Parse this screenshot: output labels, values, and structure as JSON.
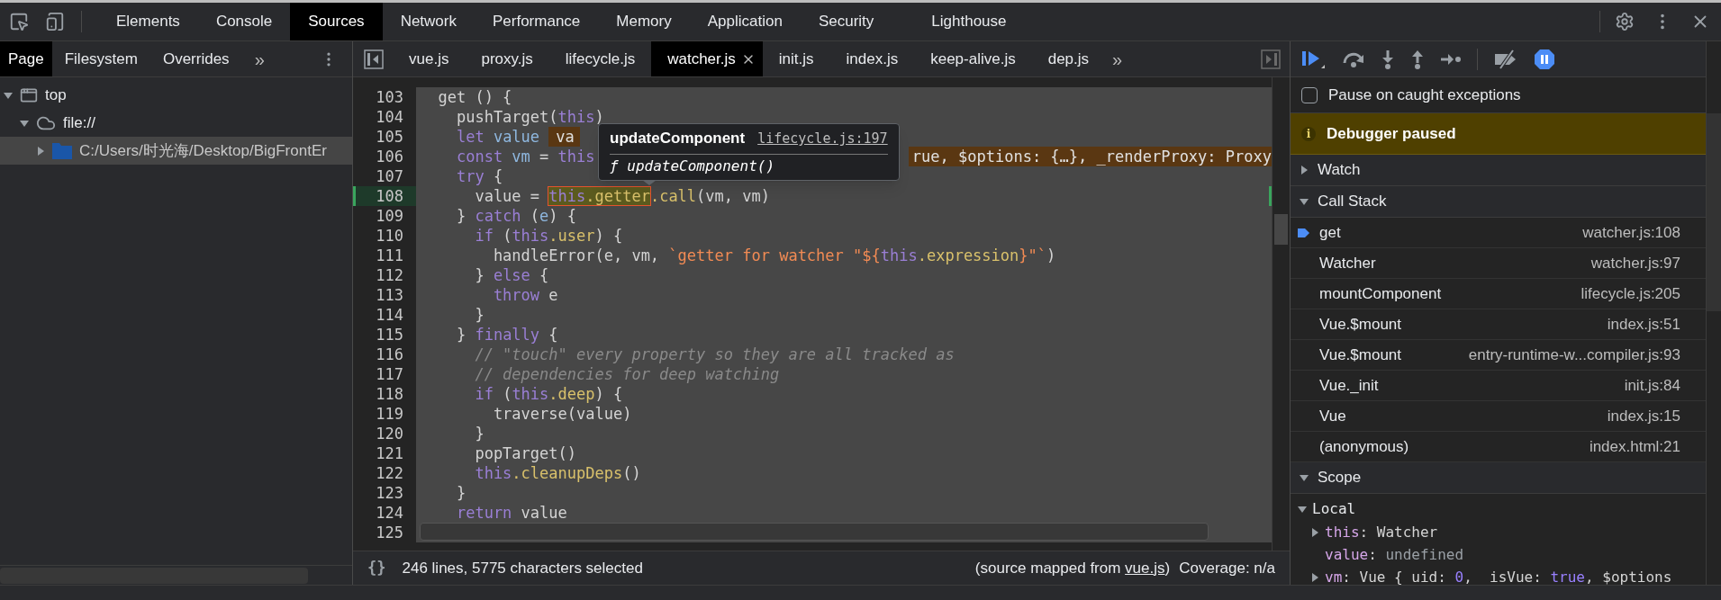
{
  "main_tabs": [
    {
      "label": "Elements",
      "selected": false
    },
    {
      "label": "Console",
      "selected": false
    },
    {
      "label": "Sources",
      "selected": true
    },
    {
      "label": "Network",
      "selected": false
    },
    {
      "label": "Performance",
      "selected": false
    },
    {
      "label": "Memory",
      "selected": false
    },
    {
      "label": "Application",
      "selected": false
    },
    {
      "label": "Security",
      "selected": false
    },
    {
      "label": "Lighthouse",
      "selected": false
    }
  ],
  "navigator": {
    "tabs": [
      {
        "label": "Page",
        "selected": true
      },
      {
        "label": "Filesystem",
        "selected": false
      },
      {
        "label": "Overrides",
        "selected": false
      }
    ],
    "more": "»",
    "tree": [
      {
        "label": "top",
        "kind": "frame",
        "expanded": true,
        "selected": false,
        "children": [
          {
            "label": "file://",
            "kind": "domain",
            "expanded": true,
            "selected": false,
            "children": [
              {
                "label": "C:/Users/时光海/Desktop/BigFrontEr",
                "kind": "folder",
                "expanded": false,
                "selected": true
              }
            ]
          }
        ]
      }
    ]
  },
  "editor": {
    "tabs": [
      {
        "label": "vue.js",
        "selected": false
      },
      {
        "label": "proxy.js",
        "selected": false
      },
      {
        "label": "lifecycle.js",
        "selected": false
      },
      {
        "label": "watcher.js",
        "selected": true
      },
      {
        "label": "init.js",
        "selected": false
      },
      {
        "label": "index.js",
        "selected": false
      },
      {
        "label": "keep-alive.js",
        "selected": false
      },
      {
        "label": "dep.js",
        "selected": false
      }
    ],
    "more": "»",
    "lines": [
      {
        "n": "103",
        "current": false,
        "tokens": [
          {
            "kind": "plain",
            "t": "  get () {"
          }
        ]
      },
      {
        "n": "104",
        "current": false,
        "tokens": [
          {
            "kind": "plain",
            "t": "    pushTarget("
          },
          {
            "kind": "kw",
            "t": "this"
          },
          {
            "kind": "plain",
            "t": ")"
          }
        ]
      },
      {
        "n": "105",
        "current": false,
        "tokens": [
          {
            "kind": "kw",
            "t": "    let"
          },
          {
            "kind": "def",
            "t": " value "
          },
          {
            "kind": "inline",
            "t": "va"
          }
        ]
      },
      {
        "n": "106",
        "current": false,
        "tokens": [
          {
            "kind": "kw",
            "t": "    const"
          },
          {
            "kind": "def",
            "t": " vm"
          },
          {
            "kind": "plain",
            "t": " = "
          },
          {
            "kind": "kw",
            "t": "this"
          },
          {
            "kind": "inline-end",
            "t": "rue, $options: {…}, _renderProxy: Proxy"
          }
        ]
      },
      {
        "n": "107",
        "current": false,
        "tokens": [
          {
            "kind": "kw",
            "t": "    try"
          },
          {
            "kind": "plain",
            "t": " {"
          }
        ]
      },
      {
        "n": "108",
        "current": true,
        "tokens": [
          {
            "kind": "plain",
            "t": "      value = "
          },
          {
            "kind": "eval",
            "parts": [
              {
                "kind": "kw",
                "t": "this"
              },
              {
                "kind": "prop",
                "t": ".getter"
              }
            ]
          },
          {
            "kind": "prop",
            "t": ".call"
          },
          {
            "kind": "plain",
            "t": "(vm, vm)"
          }
        ]
      },
      {
        "n": "109",
        "current": false,
        "tokens": [
          {
            "kind": "plain",
            "t": "    } "
          },
          {
            "kind": "kw",
            "t": "catch"
          },
          {
            "kind": "plain",
            "t": " ("
          },
          {
            "kind": "def",
            "t": "e"
          },
          {
            "kind": "plain",
            "t": ") {"
          }
        ]
      },
      {
        "n": "110",
        "current": false,
        "tokens": [
          {
            "kind": "kw",
            "t": "      if"
          },
          {
            "kind": "plain",
            "t": " ("
          },
          {
            "kind": "kw",
            "t": "this"
          },
          {
            "kind": "prop",
            "t": ".user"
          },
          {
            "kind": "plain",
            "t": ") {"
          }
        ]
      },
      {
        "n": "111",
        "current": false,
        "tokens": [
          {
            "kind": "plain",
            "t": "        handleError(e, vm, "
          },
          {
            "kind": "str",
            "t": "`getter for watcher \"${"
          },
          {
            "kind": "kw",
            "t": "this"
          },
          {
            "kind": "prop",
            "t": ".expression"
          },
          {
            "kind": "str",
            "t": "}\"`"
          },
          {
            "kind": "plain",
            "t": ")"
          }
        ]
      },
      {
        "n": "112",
        "current": false,
        "tokens": [
          {
            "kind": "plain",
            "t": "      } "
          },
          {
            "kind": "kw",
            "t": "else"
          },
          {
            "kind": "plain",
            "t": " {"
          }
        ]
      },
      {
        "n": "113",
        "current": false,
        "tokens": [
          {
            "kind": "kw",
            "t": "        throw"
          },
          {
            "kind": "plain",
            "t": " e"
          }
        ]
      },
      {
        "n": "114",
        "current": false,
        "tokens": [
          {
            "kind": "plain",
            "t": "      }"
          }
        ]
      },
      {
        "n": "115",
        "current": false,
        "tokens": [
          {
            "kind": "plain",
            "t": "    } "
          },
          {
            "kind": "kw",
            "t": "finally"
          },
          {
            "kind": "plain",
            "t": " {"
          }
        ]
      },
      {
        "n": "116",
        "current": false,
        "tokens": [
          {
            "kind": "cm",
            "t": "      // \"touch\" every property so they are all tracked as"
          }
        ]
      },
      {
        "n": "117",
        "current": false,
        "tokens": [
          {
            "kind": "cm",
            "t": "      // dependencies for deep watching"
          }
        ]
      },
      {
        "n": "118",
        "current": false,
        "tokens": [
          {
            "kind": "kw",
            "t": "      if"
          },
          {
            "kind": "plain",
            "t": " ("
          },
          {
            "kind": "kw",
            "t": "this"
          },
          {
            "kind": "prop",
            "t": ".deep"
          },
          {
            "kind": "plain",
            "t": ") {"
          }
        ]
      },
      {
        "n": "119",
        "current": false,
        "tokens": [
          {
            "kind": "plain",
            "t": "        traverse(value)"
          }
        ]
      },
      {
        "n": "120",
        "current": false,
        "tokens": [
          {
            "kind": "plain",
            "t": "      }"
          }
        ]
      },
      {
        "n": "121",
        "current": false,
        "tokens": [
          {
            "kind": "plain",
            "t": "      popTarget()"
          }
        ]
      },
      {
        "n": "122",
        "current": false,
        "tokens": [
          {
            "kind": "kw",
            "t": "      this"
          },
          {
            "kind": "prop",
            "t": ".cleanupDeps"
          },
          {
            "kind": "plain",
            "t": "()"
          }
        ]
      },
      {
        "n": "123",
        "current": false,
        "tokens": [
          {
            "kind": "plain",
            "t": "    }"
          }
        ]
      },
      {
        "n": "124",
        "current": false,
        "tokens": [
          {
            "kind": "kw",
            "t": "    return"
          },
          {
            "kind": "plain",
            "t": " value"
          }
        ]
      },
      {
        "n": "125",
        "current": false
      }
    ],
    "popover": {
      "name": "updateComponent",
      "link": "lifecycle.js:197",
      "signature": "ƒ updateComponent()"
    },
    "status": {
      "format_icon": "{}",
      "selection": "246 lines, 5775 characters selected",
      "mapped_prefix": "(source mapped from ",
      "mapped_link": "vue.js",
      "mapped_suffix": ")",
      "coverage": "Coverage: n/a"
    }
  },
  "debugger": {
    "pause_on_caught": {
      "label": "Pause on caught exceptions",
      "checked": false
    },
    "banner": {
      "icon": "i",
      "text": "Debugger paused"
    },
    "sections": [
      {
        "title": "Watch",
        "expanded": false
      },
      {
        "title": "Call Stack",
        "expanded": true
      },
      {
        "title": "Scope",
        "expanded": true
      }
    ],
    "call_stack": [
      {
        "name": "get",
        "location": "watcher.js:108",
        "current": true
      },
      {
        "name": "Watcher",
        "location": "watcher.js:97",
        "current": false
      },
      {
        "name": "mountComponent",
        "location": "lifecycle.js:205",
        "current": false
      },
      {
        "name": "Vue.$mount",
        "location": "index.js:51",
        "current": false
      },
      {
        "name": "Vue.$mount",
        "location": "entry-runtime-w...compiler.js:93",
        "current": false
      },
      {
        "name": "Vue._init",
        "location": "init.js:84",
        "current": false
      },
      {
        "name": "Vue",
        "location": "index.js:15",
        "current": false
      },
      {
        "name": "(anonymous)",
        "location": "index.html:21",
        "current": false
      }
    ],
    "scope": {
      "title": "Local",
      "expanded": true,
      "vars": [
        {
          "name": "this",
          "expandable": true,
          "value": [
            {
              "kind": "plain",
              "t": ": Watcher"
            }
          ]
        },
        {
          "name": "value",
          "expandable": false,
          "value": [
            {
              "kind": "plain",
              "t": ": "
            },
            {
              "kind": "undef",
              "t": "undefined"
            }
          ]
        },
        {
          "name": "vm",
          "expandable": true,
          "value": [
            {
              "kind": "plain",
              "t": ": Vue {_uid: "
            },
            {
              "kind": "num",
              "t": "0"
            },
            {
              "kind": "plain",
              "t": ", _isVue: "
            },
            {
              "kind": "num",
              "t": "true"
            },
            {
              "kind": "plain",
              "t": ", $options"
            }
          ]
        }
      ]
    }
  }
}
